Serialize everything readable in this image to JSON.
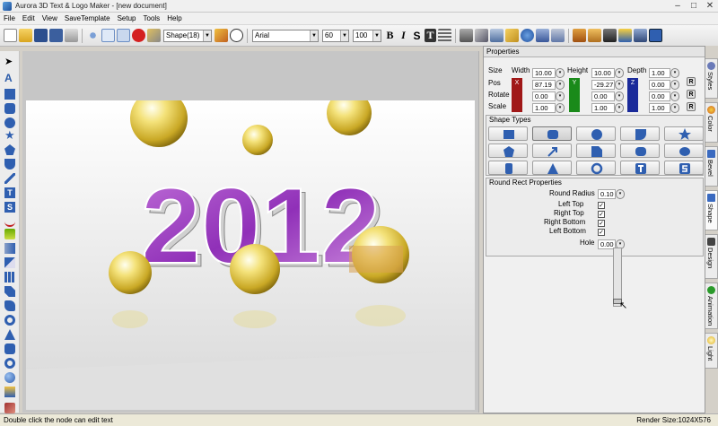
{
  "window": {
    "title": "Aurora 3D Text & Logo Maker - [new document]",
    "minimize": "–",
    "maximize": "□",
    "close": "✕"
  },
  "menu": [
    "File",
    "Edit",
    "View",
    "SaveTemplate",
    "Setup",
    "Tools",
    "Help"
  ],
  "toolbar": {
    "shape_select": "Shape(18)",
    "font": "Arial",
    "font_size": "60",
    "scale": "100",
    "bold": "B",
    "italic": "I",
    "strike": "S",
    "text_style": "T"
  },
  "canvas": {
    "text": "2012"
  },
  "properties": {
    "title": "Properties",
    "headers": {
      "size": "Size",
      "width": "Width",
      "height": "Height",
      "depth": "Depth"
    },
    "rows": [
      {
        "label": "Pos",
        "x": "87.19",
        "y": "-29.27",
        "z": "0.00"
      },
      {
        "label": "Rotate",
        "x": "0.00",
        "y": "0.00",
        "z": "0.00"
      },
      {
        "label": "Scale",
        "x": "1.00",
        "y": "1.00",
        "z": "1.00"
      }
    ],
    "size": {
      "width": "10.00",
      "height": "10.00",
      "depth": "1.00"
    },
    "reset": "R",
    "shape_types_title": "Shape Types",
    "round_rect": {
      "title": "Round Rect Properties",
      "radius_label": "Round Radius",
      "radius_value": "0.10",
      "left_top": "Left Top",
      "right_top": "Right Top",
      "right_bottom": "Right Bottom",
      "left_bottom": "Left Bottom",
      "hole_label": "Hole",
      "hole_value": "0.00",
      "check": "✓"
    }
  },
  "side_tabs": [
    "Styles",
    "Color",
    "Bevel",
    "Shape",
    "Design",
    "Animation",
    "Light"
  ],
  "status": {
    "left": "Double click the node can edit text",
    "right": "Render Size:1024X576"
  },
  "colors": {
    "x_axis": "#a01818",
    "y_axis": "#1a8a1a",
    "z_axis": "#1a2a9a",
    "text_fill": "#b050c8",
    "sphere": "#e8d24a"
  }
}
